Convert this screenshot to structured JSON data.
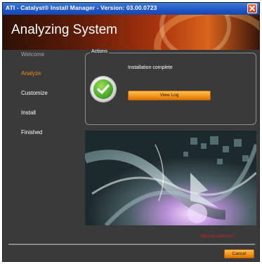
{
  "window": {
    "title": "ATI - Catalyst® Install Manager - Version: 03.00.0723"
  },
  "banner": {
    "heading": "Analyzing System"
  },
  "nav": {
    "items": [
      {
        "label": "Welcome",
        "state": "done"
      },
      {
        "label": "Analyze",
        "state": "active"
      },
      {
        "label": "Customize",
        "state": "pending"
      },
      {
        "label": "Install",
        "state": "pending"
      },
      {
        "label": "Finished",
        "state": "pending"
      }
    ]
  },
  "actions": {
    "legend": "Actions",
    "status_text": "Installation complete",
    "status_icon": "green-checkmark-icon",
    "view_log_label": "View Log"
  },
  "footer": {
    "url_text": "http://ati.amd.com",
    "cancel_label": "Cancel"
  },
  "colors": {
    "accent_orange": "#f0901e",
    "panel_bg": "#3a3a3a",
    "title_blue": "#1f54c4",
    "url_red": "#d62222",
    "success_green": "#4fa82a"
  }
}
